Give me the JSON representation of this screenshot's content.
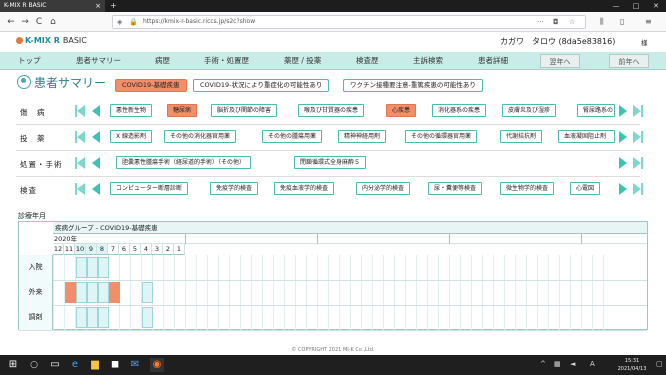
{
  "browser": {
    "tab_title": "K-MIX R BASIC",
    "new_tab": "+",
    "url": "https://kmix-r-basic.riccs.jp/s2c?show",
    "nav": {
      "back": "←",
      "forward": "→",
      "reload": "C",
      "home": "⌂"
    },
    "win": {
      "min": "—",
      "max": "□",
      "close": "✕"
    }
  },
  "app": {
    "logo": "K-MIX R",
    "logo_basic": "BASIC",
    "patient_name": "カガワ　タロウ (8da5e83816)",
    "honorific": "様"
  },
  "tabs": [
    "トップ",
    "患者サマリー",
    "病歴",
    "手術・処置歴",
    "薬歴 / 投薬",
    "検査歴",
    "主訴検索",
    "患者詳細"
  ],
  "year_buttons": {
    "prev": "翌年へ",
    "next": "前年へ"
  },
  "summary": {
    "title": "患者サマリー",
    "pills": [
      {
        "label": "COVID19-基礎疾患",
        "active": true
      },
      {
        "label": "COVID19-状況により重症化の可能性あり",
        "active": false
      },
      {
        "label": "ワクチン接種要注意-重篤疾患の可能性あり",
        "active": false
      }
    ]
  },
  "categories": [
    {
      "label": "傷　病",
      "chips": [
        {
          "label": "悪性新生物",
          "active": false
        },
        {
          "label": "糖尿病",
          "active": true
        },
        {
          "label": "脳折及び関節の障害",
          "active": false
        },
        {
          "label": "喉及び甘質器の疾患",
          "active": false
        },
        {
          "label": "心疾患",
          "active": true
        },
        {
          "label": "消化器系の疾患",
          "active": false
        },
        {
          "label": "皮膚炎及び湿疹",
          "active": false
        },
        {
          "label": "腎尿路系の",
          "active": false
        }
      ]
    },
    {
      "label": "投　薬",
      "chips": [
        {
          "label": "X 線造影剤",
          "active": false
        },
        {
          "label": "その他の消化器官用薬",
          "active": false
        },
        {
          "label": "その他の腫瘍用薬",
          "active": false
        },
        {
          "label": "精神神経用剤",
          "active": false
        },
        {
          "label": "その他の循環器官用薬",
          "active": false
        },
        {
          "label": "代謝拮抗剤",
          "active": false
        },
        {
          "label": "血液凝固阻止剤",
          "active": false
        }
      ]
    },
    {
      "label": "処置・手術",
      "chips": [
        {
          "label": "胆囊悪性腫瘍手術（経尿道的手術）（その他）",
          "active": false
        },
        {
          "label": "閉鎖循環式全身麻酔５",
          "active": false
        }
      ]
    },
    {
      "label": "検査",
      "chips": [
        {
          "label": "コンピューター断層診断",
          "active": false
        },
        {
          "label": "免疫学的検査",
          "active": false
        },
        {
          "label": "免疫血液学的検査",
          "active": false
        },
        {
          "label": "内分泌学的検査",
          "active": false
        },
        {
          "label": "尿・糞便等検査",
          "active": false
        },
        {
          "label": "微生物学的検査",
          "active": false
        },
        {
          "label": "心電図",
          "active": false
        }
      ]
    }
  ],
  "timeline": {
    "label": "診療年月",
    "group": "疾病グループ - COVID19-基礎疾患",
    "year": "2020年",
    "months": [
      "12",
      "11",
      "10",
      "9",
      "8",
      "7",
      "6",
      "5",
      "4",
      "3",
      "2",
      "1"
    ],
    "highlight_months": [
      "10",
      "9",
      "8"
    ],
    "rows": [
      {
        "label": "入院",
        "orange": [],
        "cyan": [
          "10",
          "9",
          "8"
        ]
      },
      {
        "label": "外来",
        "orange": [
          "11",
          "7"
        ],
        "cyan": [
          "10",
          "9",
          "8",
          "4"
        ]
      },
      {
        "label": "調剤",
        "orange": [],
        "cyan": [
          "10",
          "9",
          "8",
          "4"
        ]
      }
    ]
  },
  "footer": "© COPYRIGHT 2021 MI-K Co.,Ltd.",
  "taskbar": {
    "time": "15:31",
    "date": "2021/04/13",
    "lang": "A"
  },
  "colors": {
    "accent": "#2b7f90",
    "active_chip": "#f28f6a",
    "tab_bar": "#c9ece9",
    "border": "#4bbab1"
  }
}
